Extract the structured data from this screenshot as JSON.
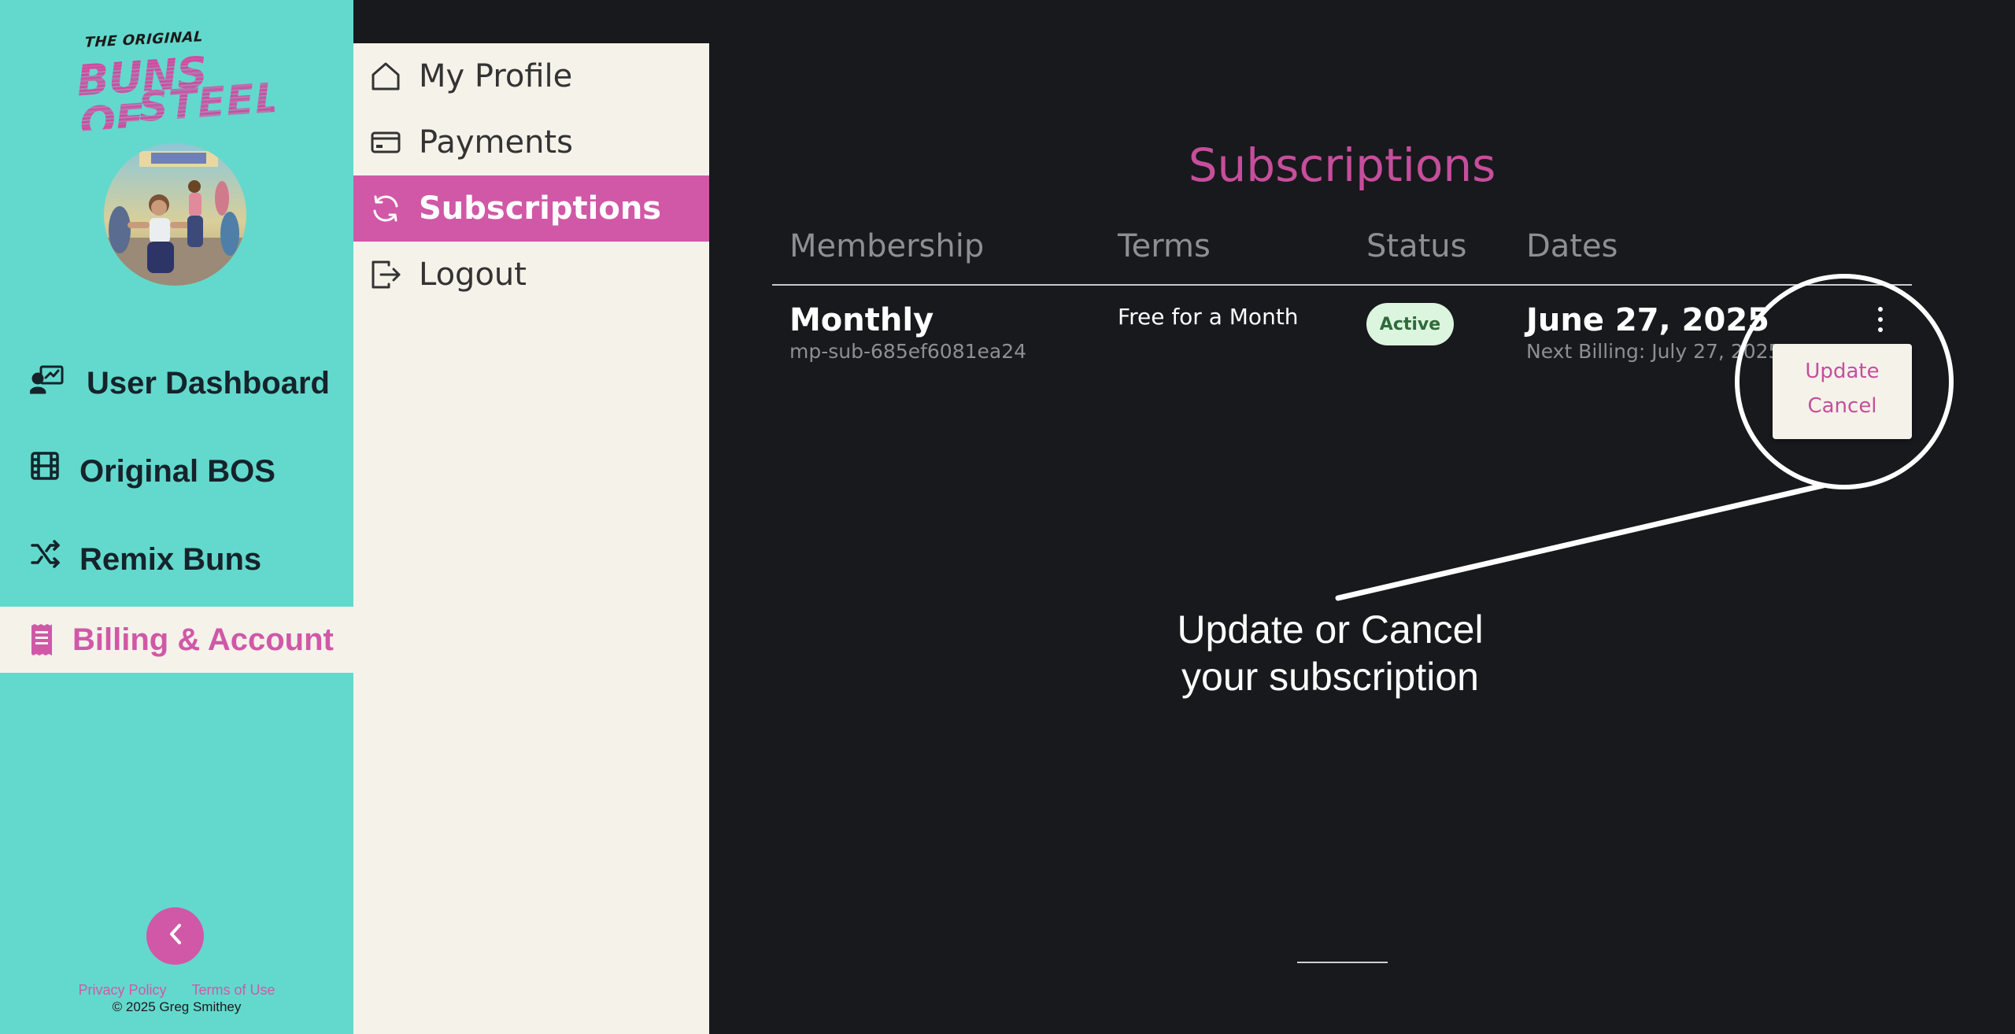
{
  "brand": {
    "logo_top": "THE ORIGINAL",
    "logo_line1": "BUNS OF",
    "logo_line2": "STEEL",
    "accent_color": "#d058a7",
    "sidebar_color": "#63d9cd",
    "panel_color": "#f5f2ea"
  },
  "sidebar": {
    "items": [
      {
        "label": "User Dashboard",
        "icon": "user-chart-icon",
        "active": false
      },
      {
        "label": "Original BOS",
        "icon": "film-icon",
        "active": false
      },
      {
        "label": "Remix Buns",
        "icon": "shuffle-icon",
        "active": false
      },
      {
        "label": "Billing & Account",
        "icon": "receipt-icon",
        "active": true
      }
    ],
    "collapse_icon": "chevron-left-icon",
    "footer": {
      "privacy": "Privacy Policy",
      "terms": "Terms of Use",
      "copyright": "© 2025 Greg Smithey"
    }
  },
  "subnav": {
    "items": [
      {
        "label": "My Profile",
        "icon": "home-icon",
        "active": false
      },
      {
        "label": "Payments",
        "icon": "credit-card-icon",
        "active": false
      },
      {
        "label": "Subscriptions",
        "icon": "refresh-icon",
        "active": true
      },
      {
        "label": "Logout",
        "icon": "logout-icon",
        "active": false
      }
    ]
  },
  "main": {
    "title": "Subscriptions",
    "columns": [
      "Membership",
      "Terms",
      "Status",
      "Dates"
    ],
    "rows": [
      {
        "membership": "Monthly",
        "id": "mp-sub-685ef6081ea24",
        "terms": "Free for a Month",
        "status": "Active",
        "date": "June 27, 2025",
        "next_billing": "Next Billing: July 27, 2025"
      }
    ],
    "menu": [
      "Update",
      "Cancel"
    ]
  },
  "callout": {
    "line1": "Update or Cancel",
    "line2": "your subscription"
  }
}
